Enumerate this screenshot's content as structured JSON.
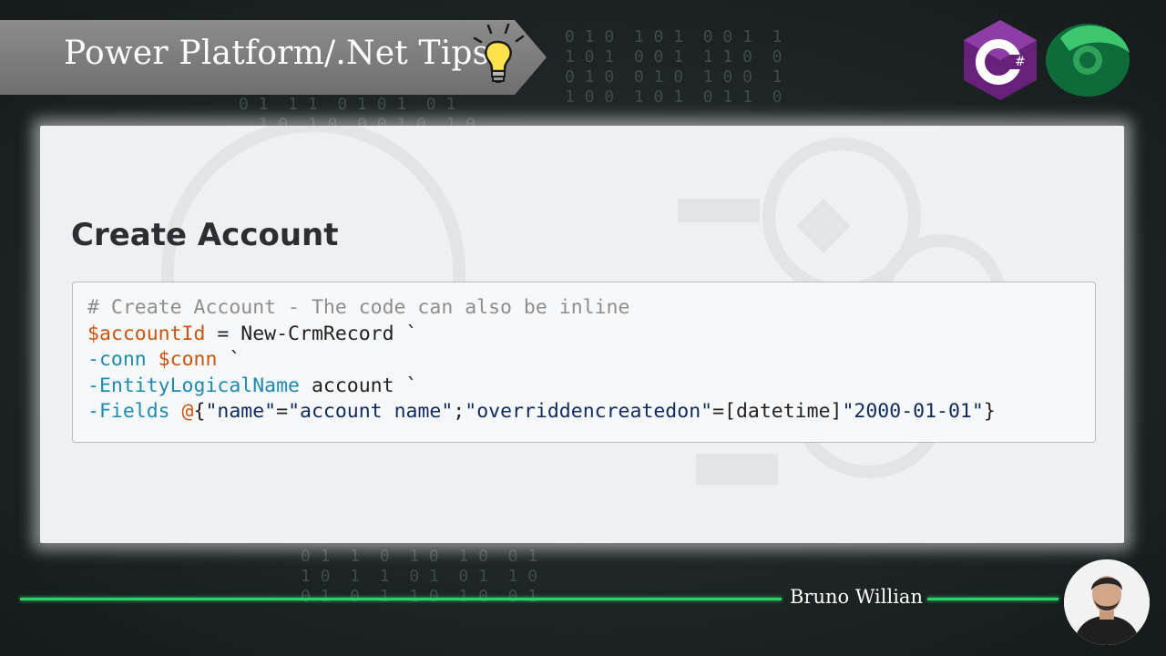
{
  "header": {
    "title": "Power Platform/.Net Tips",
    "bulb_icon": "lightbulb-icon",
    "logos": [
      "csharp-logo",
      "dataverse-logo"
    ]
  },
  "slide": {
    "heading": "Create Account",
    "code": {
      "comment": "# Create Account - The code can also be inline",
      "line2_var": "$accountId",
      "line2_rest": " = New-CrmRecord `",
      "line3_param": "-conn",
      "line3_var": " $conn",
      "line3_rest": " `",
      "line4_param": "-EntityLogicalName",
      "line4_rest": " account `",
      "line5_param": "-Fields",
      "line5_at": " @",
      "line5_b1": "{",
      "line5_s1": "\"name\"",
      "line5_eq1": "=",
      "line5_s2": "\"account name\"",
      "line5_semi": ";",
      "line5_s3": "\"overriddencreatedon\"",
      "line5_eq2": "=[datetime]",
      "line5_s4": "\"2000-01-01\"",
      "line5_b2": "}"
    }
  },
  "footer": {
    "author": "Bruno Willian",
    "accent": "#2fd06a"
  },
  "colors": {
    "background": "#1b2222",
    "panel": "#eff0f1",
    "variable": "#c9540e",
    "parameter": "#1d8ab1",
    "string": "#0f2a5e",
    "comment": "#8e8e8e"
  }
}
